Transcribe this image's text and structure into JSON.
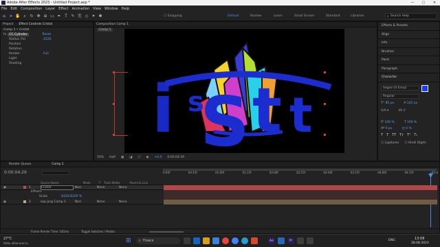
{
  "window": {
    "title": "Adobe After Effects 2023 - Untitled Project.aep *",
    "min": "—",
    "max": "▢",
    "close": "✕"
  },
  "menu": [
    "File",
    "Edit",
    "Composition",
    "Layer",
    "Effect",
    "Animation",
    "View",
    "Window",
    "Help"
  ],
  "toolbar": {
    "snapping": "Snapping",
    "workspaces": [
      "Default",
      "Review",
      "Learn",
      "Small Screen",
      "Standard",
      "Libraries"
    ],
    "search_placeholder": "Search Help"
  },
  "left_panel": {
    "tabs": [
      "Project",
      "Effect Controls Cristal"
    ],
    "title": "Comp 1 • Cristal",
    "effect_name": "CC Cylinder",
    "reset": "Reset",
    "rows": [
      {
        "label": "Radius (%)",
        "value": "2220"
      },
      {
        "label": "Position",
        "value": ""
      },
      {
        "label": "Rotation",
        "value": ""
      },
      {
        "label": "Render",
        "value": "Full"
      },
      {
        "label": "Light",
        "value": ""
      },
      {
        "label": "Shading",
        "value": ""
      }
    ]
  },
  "comp_panel": {
    "tab": "Composition Comp 1",
    "crumb": "Comp 1",
    "zoom": "50%",
    "quality": "Half",
    "exposure": "+0.0",
    "timecode": "0:00:04:29"
  },
  "right_panel": {
    "items": [
      "Effects & Presets",
      "Align",
      "Info",
      "Brushes",
      "Paint",
      "Paragraph"
    ],
    "character_title": "Character",
    "font": "Segoe UI Emoji",
    "style": "Regular",
    "size": "85 px",
    "leading": "142 px",
    "tracking": "0",
    "vscale": "100 %",
    "hscale": "100 %",
    "baseline": "0 px",
    "tsume": "0 %",
    "ligatures": "Ligatures",
    "hindi": "Hindi Digits",
    "fill_color": "#1a3cff"
  },
  "timeline": {
    "tabs": [
      "Render Queue",
      "Comp 1"
    ],
    "timecode": "0:00:04:29",
    "headers": [
      "Source Name",
      "Mode",
      "T",
      "Track Matte",
      "Parent & Link"
    ],
    "layers": [
      {
        "num": "1",
        "name": "Cristal",
        "mode": "Norr",
        "matte": "None",
        "parent": "None",
        "color": "#c64a4a"
      },
      {
        "num": "2",
        "name": "exp.png Comp 1",
        "mode": "Norr",
        "matte": "None",
        "parent": "None",
        "color": "#c7a97a"
      }
    ],
    "effects_label": "Effects",
    "scale_label": "Scale",
    "scale_value": "8320,8320 %",
    "ruler": [
      "0:00f",
      "00:15f",
      "01:00f",
      "01:15f",
      "02:00f",
      "02:15f",
      "03:00f",
      "03:15f",
      "04:00f",
      "04:15f",
      "05:0"
    ],
    "footer_left": "Frame Render Time: 181ms",
    "footer_mid": "Toggle Switches / Modes"
  },
  "taskbar": {
    "weather": "27°C",
    "weather_sub": "Небь облачность",
    "search": "Поиск",
    "lang": "ENG",
    "time": "13:08",
    "date": "28.08.2023"
  }
}
